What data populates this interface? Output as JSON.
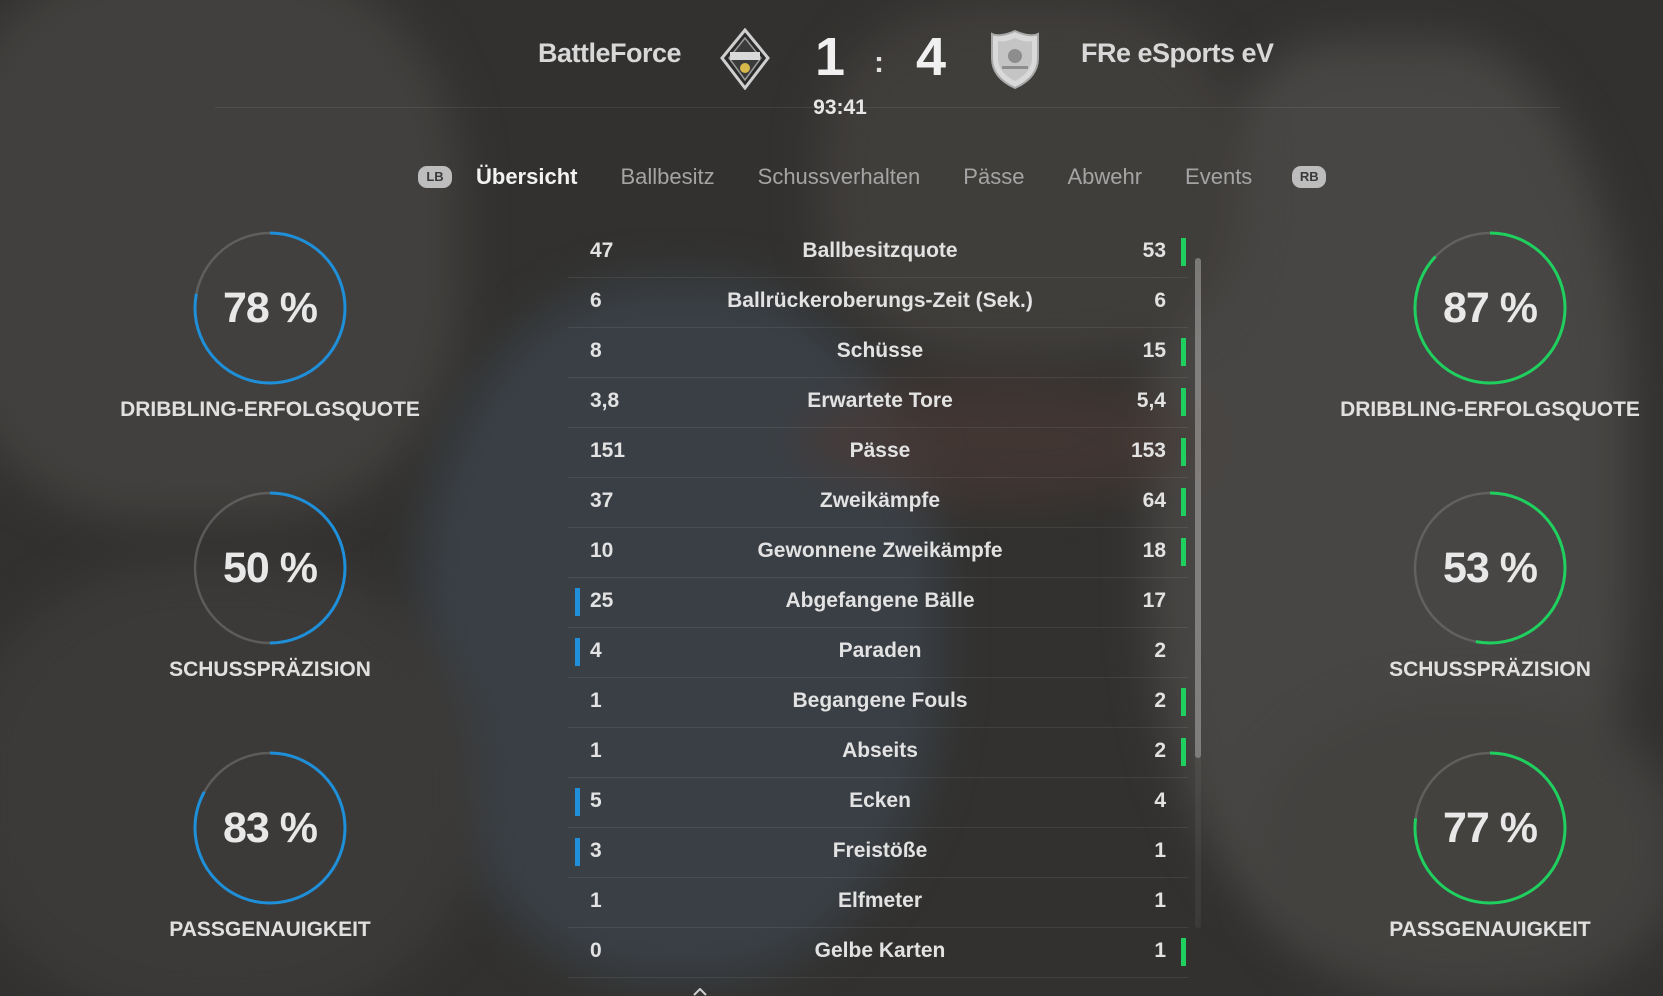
{
  "match": {
    "home_team": "BattleForce",
    "away_team": "FRe eSports eV",
    "home_score": "1",
    "away_score": "4",
    "separator": ":",
    "clock": "93:41",
    "home_crest_icon": "battleforce-crest-icon",
    "away_crest_icon": "fre-esports-crest-icon"
  },
  "tabs": {
    "lb": "LB",
    "rb": "RB",
    "items": [
      {
        "label": "Übersicht",
        "active": true
      },
      {
        "label": "Ballbesitz",
        "active": false
      },
      {
        "label": "Schussverhalten",
        "active": false
      },
      {
        "label": "Pässe",
        "active": false
      },
      {
        "label": "Abwehr",
        "active": false
      },
      {
        "label": "Events",
        "active": false
      }
    ]
  },
  "colors": {
    "home_accent": "#1e8fd8",
    "away_accent": "#1fd05f"
  },
  "home_rings": [
    {
      "value": "78 %",
      "percent": 78,
      "label": "DRIBBLING-ERFOLGSQUOTE"
    },
    {
      "value": "50 %",
      "percent": 50,
      "label": "SCHUSSPRÄZISION"
    },
    {
      "value": "83 %",
      "percent": 83,
      "label": "PASSGENAUIGKEIT"
    }
  ],
  "away_rings": [
    {
      "value": "87 %",
      "percent": 87,
      "label": "DRIBBLING-ERFOLGSQUOTE"
    },
    {
      "value": "53 %",
      "percent": 53,
      "label": "SCHUSSPRÄZISION"
    },
    {
      "value": "77 %",
      "percent": 77,
      "label": "PASSGENAUIGKEIT"
    }
  ],
  "stats": [
    {
      "home": "47",
      "label": "Ballbesitzquote",
      "away": "53",
      "leader": "away"
    },
    {
      "home": "6",
      "label": "Ballrückeroberungs-Zeit (Sek.)",
      "away": "6",
      "leader": "none"
    },
    {
      "home": "8",
      "label": "Schüsse",
      "away": "15",
      "leader": "away"
    },
    {
      "home": "3,8",
      "label": "Erwartete Tore",
      "away": "5,4",
      "leader": "away"
    },
    {
      "home": "151",
      "label": "Pässe",
      "away": "153",
      "leader": "away"
    },
    {
      "home": "37",
      "label": "Zweikämpfe",
      "away": "64",
      "leader": "away"
    },
    {
      "home": "10",
      "label": "Gewonnene Zweikämpfe",
      "away": "18",
      "leader": "away"
    },
    {
      "home": "25",
      "label": "Abgefangene Bälle",
      "away": "17",
      "leader": "home"
    },
    {
      "home": "4",
      "label": "Paraden",
      "away": "2",
      "leader": "home"
    },
    {
      "home": "1",
      "label": "Begangene Fouls",
      "away": "2",
      "leader": "away"
    },
    {
      "home": "1",
      "label": "Abseits",
      "away": "2",
      "leader": "away"
    },
    {
      "home": "5",
      "label": "Ecken",
      "away": "4",
      "leader": "home"
    },
    {
      "home": "3",
      "label": "Freistöße",
      "away": "1",
      "leader": "home"
    },
    {
      "home": "1",
      "label": "Elfmeter",
      "away": "1",
      "leader": "none"
    },
    {
      "home": "0",
      "label": "Gelbe Karten",
      "away": "1",
      "leader": "away"
    }
  ]
}
